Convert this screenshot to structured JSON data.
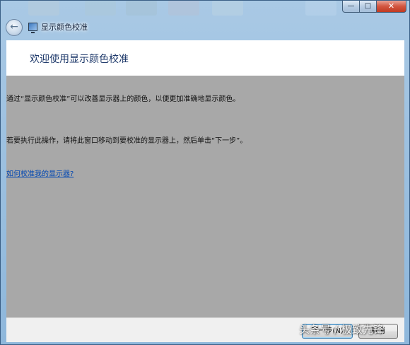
{
  "window": {
    "title": "显示颜色校准"
  },
  "header": {
    "title": "欢迎使用显示颜色校准"
  },
  "body": {
    "paragraph1": "通过“显示颜色校准”可以改善显示器上的颜色，以便更加准确地显示颜色。",
    "paragraph2": "若要执行此操作，请将此窗口移动到要校准的显示器上，然后单击“下一步”。",
    "help_link": "如何校准我的显示器?"
  },
  "footer": {
    "next_label": "下一步(N)",
    "cancel_label": "取消"
  },
  "watermark": "头条号 / 极致先锋",
  "icons": [
    "back-arrow-icon",
    "display-calibration-icon",
    "minimize-icon",
    "maximize-icon",
    "close-icon"
  ],
  "colors": {
    "header_background": "#ffffff",
    "body_background": "#a8a8a8",
    "header_text": "#1f3a6b",
    "link": "#0047b3"
  }
}
